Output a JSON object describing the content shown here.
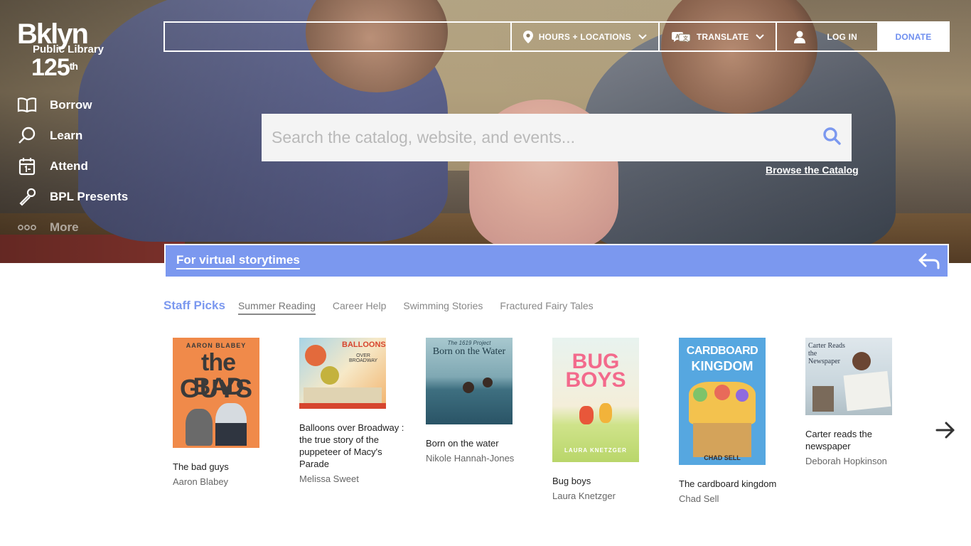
{
  "logo": {
    "line1": "Bklyn",
    "line2": "Public Library",
    "line3": "125",
    "line3_sup": "th"
  },
  "nav": [
    {
      "label": "Borrow",
      "icon": "book-icon"
    },
    {
      "label": "Learn",
      "icon": "magnifier-icon"
    },
    {
      "label": "Attend",
      "icon": "calendar-icon"
    },
    {
      "label": "BPL Presents",
      "icon": "microphone-icon"
    },
    {
      "label": "More",
      "icon": "dots-icon"
    }
  ],
  "topbar": {
    "hours": "HOURS + LOCATIONS",
    "translate": "TRANSLATE",
    "login": "LOG IN",
    "donate": "DONATE"
  },
  "search": {
    "placeholder": "Search the catalog, website, and events..."
  },
  "browse_catalog": "Browse the Catalog",
  "banner": {
    "text": "For virtual storytimes"
  },
  "tabs": {
    "primary": "Staff Picks",
    "items": [
      "Summer Reading",
      "Career Help",
      "Swimming Stories",
      "Fractured Fairy Tales"
    ]
  },
  "books": [
    {
      "title": "The bad guys",
      "author": "Aaron Blabey",
      "cover_author": "AARON BLABEY",
      "cover_title_1": "the BAD",
      "cover_title_2": "GUYS"
    },
    {
      "title": "Balloons over Broadway : the true story of the puppeteer of Macy's Parade",
      "author": "Melissa Sweet",
      "cover_title_1": "BALLOONS",
      "cover_title_2": "OVER BROADWAY"
    },
    {
      "title": "Born on the water",
      "author": "Nikole Hannah-Jones",
      "cover_top": "The 1619 Project",
      "cover_title_1": "Born on the Water"
    },
    {
      "title": "Bug boys",
      "author": "Laura Knetzger",
      "cover_title_1": "BUG",
      "cover_title_2": "BOYS",
      "cover_author": "LAURA KNETZGER"
    },
    {
      "title": "The cardboard kingdom",
      "author": "Chad Sell",
      "cover_title_1": "CARDBOARD",
      "cover_title_2": "KINGDOM",
      "cover_author": "CHAD SELL"
    },
    {
      "title": "Carter reads the newspaper",
      "author": "Deborah Hopkinson",
      "cover_title_1": "Carter Reads the Newspaper"
    }
  ]
}
